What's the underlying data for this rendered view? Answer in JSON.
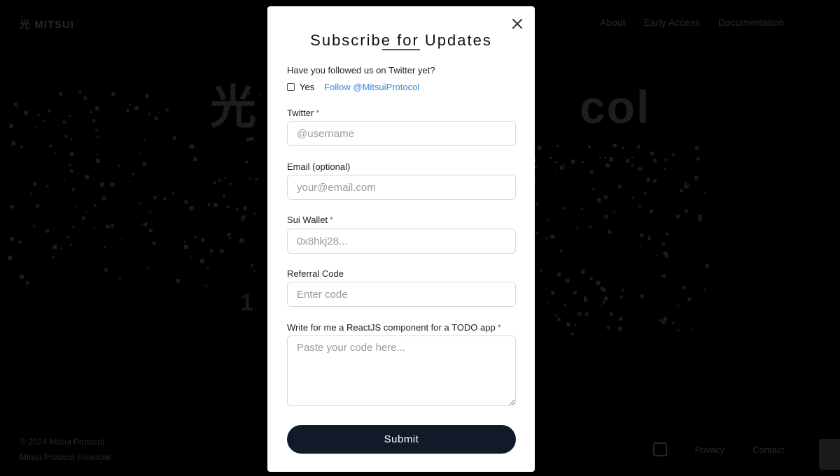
{
  "background": {
    "logo": "光 MITSUI",
    "nav": [
      "About",
      "Early Access",
      "Documentation"
    ],
    "hero_left": "光",
    "hero_right": "col",
    "step_number": "1",
    "footer_left": [
      "© 2024 Mitsui Protocol",
      "Mitsui Protocol Financial"
    ],
    "footer_right": [
      "Privacy",
      "Contact"
    ]
  },
  "modal": {
    "title": "Subscribe for Updates",
    "twitter_question": "Have you followed us on Twitter yet?",
    "yes_label": "Yes",
    "follow_link": "Follow @MitsuiProtocol",
    "fields": {
      "twitter": {
        "label": "Twitter",
        "required": "*",
        "placeholder": "@username"
      },
      "email": {
        "label": "Email (optional)",
        "placeholder": "your@email.com"
      },
      "wallet": {
        "label": "Sui Wallet",
        "required": "*",
        "placeholder": "0x8hkj28..."
      },
      "referral": {
        "label": "Referral Code",
        "placeholder": "Enter code"
      },
      "code": {
        "label": "Write for me a ReactJS component for a TODO app",
        "required": "*",
        "placeholder": "Paste your code here..."
      }
    },
    "submit_label": "Submit"
  },
  "colors": {
    "overlay": "#000000",
    "submit_bg": "#121a2a",
    "link": "#3b82d6",
    "required": "#e0413f"
  },
  "icons": {
    "close": "close-icon"
  }
}
